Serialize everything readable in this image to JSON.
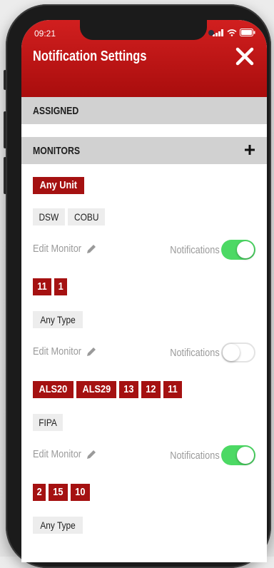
{
  "status": {
    "time": "09:21"
  },
  "header": {
    "title": "Notification Settings"
  },
  "sections": {
    "assigned": "ASSIGNED",
    "monitors": "MONITORS"
  },
  "monitors": [
    {
      "units": [
        "Any Unit"
      ],
      "types": [
        "DSW",
        "COBU"
      ],
      "edit_label": "Edit Monitor",
      "notifications_label": "Notifications",
      "notifications_on": true
    },
    {
      "units": [
        "11",
        "1"
      ],
      "types": [
        "Any Type"
      ],
      "edit_label": "Edit Monitor",
      "notifications_label": "Notifications",
      "notifications_on": false
    },
    {
      "units": [
        "ALS20",
        "ALS29",
        "13",
        "12",
        "11"
      ],
      "types": [
        "FIPA"
      ],
      "edit_label": "Edit Monitor",
      "notifications_label": "Notifications",
      "notifications_on": true
    },
    {
      "units": [
        "2",
        "15",
        "10"
      ],
      "types": [
        "Any Type"
      ]
    }
  ],
  "colors": {
    "header_red": "#c41414",
    "tag_red": "#a51111",
    "toggle_on": "#4cd964",
    "section_gray": "#d1d1d1"
  },
  "icons": {
    "close": "close-icon",
    "add": "plus-icon",
    "edit": "pencil-icon"
  }
}
